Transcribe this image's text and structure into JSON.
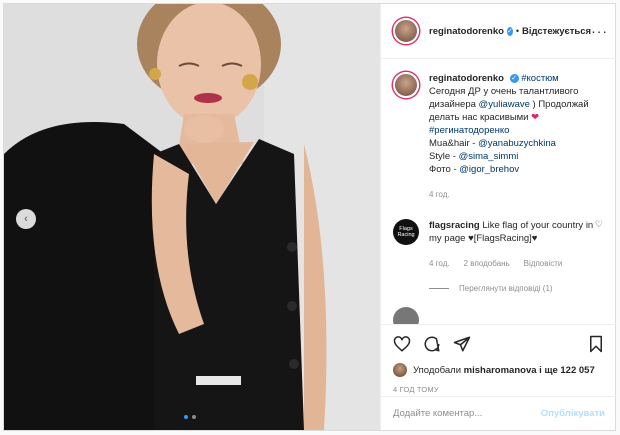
{
  "post": {
    "username": "reginatodorenko",
    "follow_separator": "•",
    "follow_label": "Відстежується",
    "more": "···",
    "caption": {
      "hashtag_1": "#костюм",
      "line_1": "Сегодня ДР у очень талантливого дизайнера",
      "mention_designer": "@yuliawave",
      "line_2": ") Продолжай делать нас красивыми",
      "heart": "❤",
      "hashtag_2": "#регинатодоренко",
      "mua_label": "Mua&hair -",
      "mua_mention": "@yanabuzychkina",
      "style_label": "Style -",
      "style_mention": "@sima_simmi",
      "photo_label": "Фото -",
      "photo_mention": "@igor_brehov",
      "time": "4 год."
    },
    "comments": [
      {
        "avatar_text": "Flags Racing",
        "username": "flagsracing",
        "text": "Like flag of your country in my page ♥[FlagsRacing]♥",
        "time": "4 год.",
        "likes": "2 вподобань",
        "reply": "Відповісти",
        "view_replies": "Переглянути відповіді (1)"
      }
    ],
    "likes_prefix": "Уподобали",
    "likes_user": "misharomanova",
    "likes_suffix": "і ще 122 057",
    "posted_time": "4 ГОД ТОМУ",
    "comment_placeholder": "Додайте коментар...",
    "publish_label": "Опублікувати"
  },
  "colors": {
    "link": "#00376b",
    "accent": "#3897f0",
    "publish_disabled": "#b2dffc"
  },
  "icons": [
    "heart-icon",
    "comment-icon",
    "share-icon",
    "bookmark-icon",
    "chevron-left-icon",
    "verified-icon"
  ]
}
